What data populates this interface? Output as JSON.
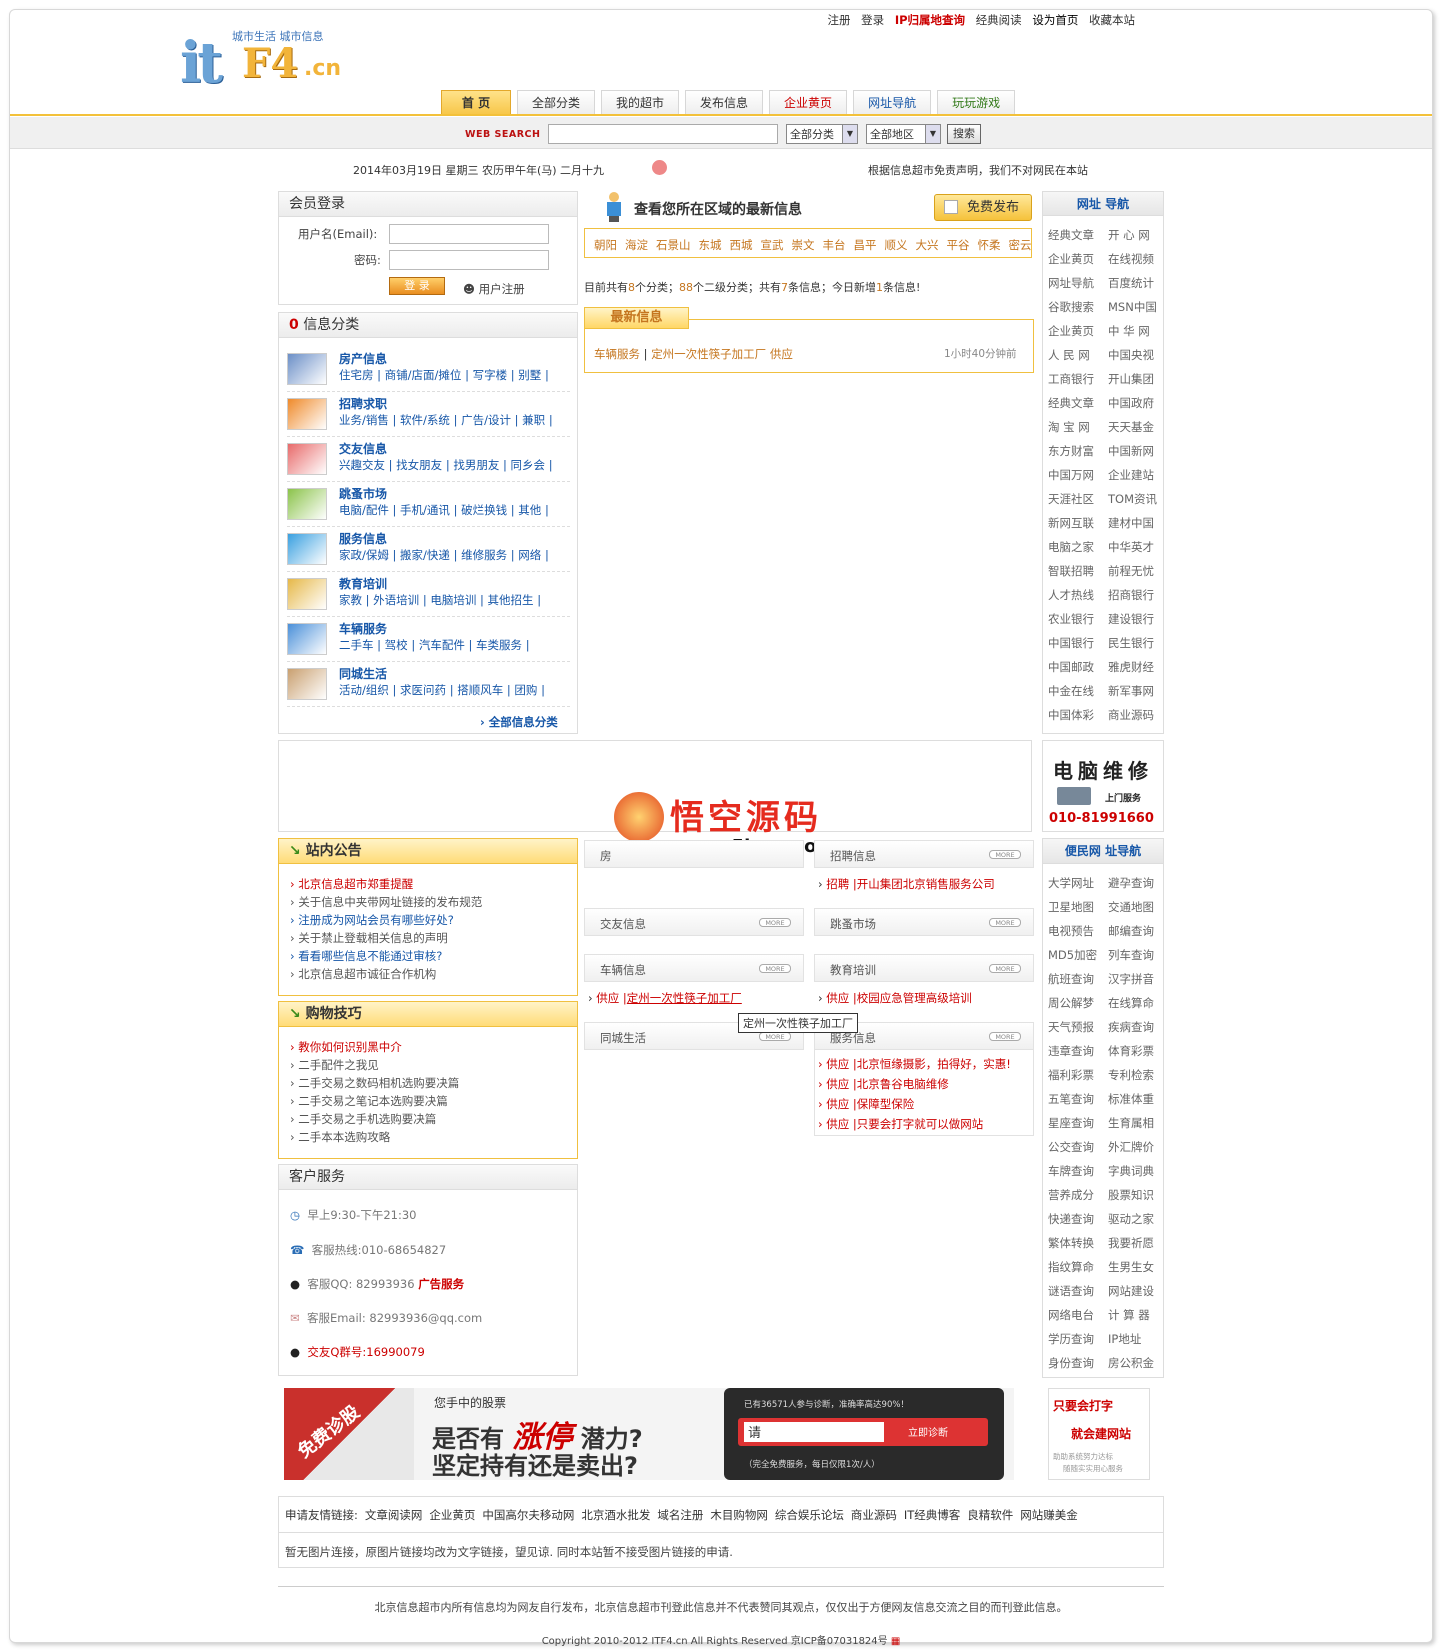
{
  "header": {
    "logo_tagline": "城市生活  城市信息",
    "logo_it": "it",
    "logo_f4": "F4",
    "logo_cn": ".cn",
    "top_links": [
      "注册",
      "登录",
      "IP归属地查询",
      "经典阅读",
      "设为首页",
      "收藏本站"
    ]
  },
  "tabs": [
    "首 页",
    "全部分类",
    "我的超市",
    "发布信息",
    "企业黄页",
    "网址导航",
    "玩玩游戏"
  ],
  "search": {
    "label": "WEB SEARCH",
    "category": "全部分类",
    "region": "全部地区",
    "button": "搜索"
  },
  "date_text": "2014年03月19日  星期三  农历甲午年(马) 二月十九",
  "notice_text": "根据信息超市免责声明，我们不对网民在本站",
  "login": {
    "title": "会员登录",
    "username_label": "用户名(Email):",
    "password_label": "密码:",
    "login_button": "登 录",
    "register": "用户注册"
  },
  "categories": {
    "title_num": "0",
    "title": "信息分类",
    "more": "全部信息分类",
    "items": [
      {
        "title": "房产信息",
        "subs": "住宅房 | 商铺/店面/摊位 | 写字楼 | 别墅 |",
        "color": "#6b8fc7"
      },
      {
        "title": "招聘求职",
        "subs": "业务/销售 | 软件/系统 | 广告/设计 | 兼职 |",
        "color": "#ef8a2a"
      },
      {
        "title": "交友信息",
        "subs": "兴趣交友 | 找女朋友 | 找男朋友 | 同乡会 |",
        "color": "#e86a6a"
      },
      {
        "title": "跳蚤市场",
        "subs": "电脑/配件 | 手机/通讯 | 破烂换钱 | 其他 |",
        "color": "#8bc34a"
      },
      {
        "title": "服务信息",
        "subs": "家政/保姆 | 搬家/快递 | 维修服务 | 网络 |",
        "color": "#39a0e0"
      },
      {
        "title": "教育培训",
        "subs": "家教 | 外语培训 | 电脑培训 | 其他招生 |",
        "color": "#e6b848"
      },
      {
        "title": "车辆服务",
        "subs": "二手车 | 驾校 | 汽车配件 | 车类服务 |",
        "color": "#4a90d9"
      },
      {
        "title": "同城生活",
        "subs": "活动/组织 | 求医问药 | 搭顺风车 | 团购 |",
        "color": "#c9a070"
      }
    ]
  },
  "region": {
    "title": "查看您所在区域的最新信息",
    "publish": "免费发布",
    "districts": [
      "朝阳",
      "海淀",
      "石景山",
      "东城",
      "西城",
      "宣武",
      "崇文",
      "丰台",
      "昌平",
      "顺义",
      "大兴",
      "平谷",
      "怀柔",
      "密云"
    ],
    "stats_prefix": "目前共有",
    "stats_num1": "8",
    "stats_mid1": "个分类；",
    "stats_num2": "88",
    "stats_mid2": "个二级分类；共有",
    "stats_num3": "7",
    "stats_mid3": "条信息；今日新增",
    "stats_num4": "1",
    "stats_suffix": "条信息!"
  },
  "latest": {
    "title": "最新信息",
    "category": "车辆服务",
    "item": "定州一次性筷子加工厂",
    "tag": "供应",
    "time": "1小时40分钟前"
  },
  "sitenav": {
    "title": "网址 导航",
    "links": [
      "经典文章",
      "开 心 网",
      "企业黄页",
      "在线视频",
      "网址导航",
      "百度统计",
      "谷歌搜索",
      "MSN中国",
      "企业黄页",
      "中 华 网",
      "人 民 网",
      "中国央视",
      "工商银行",
      "开山集团",
      "经典文章",
      "中国政府",
      "淘 宝 网",
      "天天基金",
      "东方财富",
      "中国新网",
      "中国万网",
      "企业建站",
      "天涯社区",
      "TOM资讯",
      "新网互联",
      "建材中国",
      "电脑之家",
      "中华英才",
      "智联招聘",
      "前程无忧",
      "人才热线",
      "招商银行",
      "农业银行",
      "建设银行",
      "中国银行",
      "民生银行",
      "中国邮政",
      "雅虎财经",
      "中金在线",
      "新军事网",
      "中国体彩",
      "商业源码"
    ]
  },
  "ad_repair": {
    "title": "电脑维修",
    "sub": "上门服务",
    "phone": "010-81991660"
  },
  "watermark": {
    "title": "悟空源码",
    "url": "www.5kym.com"
  },
  "announce": {
    "title": "站内公告",
    "items": [
      {
        "text": "北京信息超市郑重提醒",
        "style": "red"
      },
      {
        "text": "关于信息中夹带网址链接的发布规范",
        "style": ""
      },
      {
        "text": "注册成为网站会员有哪些好处?",
        "style": "blue"
      },
      {
        "text": "关于禁止登载相关信息的声明",
        "style": ""
      },
      {
        "text": "看看哪些信息不能通过审核?",
        "style": "blue"
      },
      {
        "text": "北京信息超市诚征合作机构",
        "style": ""
      }
    ]
  },
  "shopping": {
    "title": "购物技巧",
    "items": [
      {
        "text": "教你如何识别黑中介",
        "style": "red"
      },
      {
        "text": "二手配件之我见",
        "style": ""
      },
      {
        "text": "二手交易之数码相机选购要决篇",
        "style": ""
      },
      {
        "text": "二手交易之笔记本选购要决篇",
        "style": ""
      },
      {
        "text": "二手交易之手机选购要决篇",
        "style": ""
      },
      {
        "text": "二手本本选购攻略",
        "style": ""
      }
    ]
  },
  "service": {
    "title": "客户服务",
    "hours": "早上9:30-下午21:30",
    "hotline": "客服热线:010-68654827",
    "qq": "客服QQ: 82993936",
    "qq_ad": "广告服务",
    "email": "客服Email: 82993936@qq.com",
    "group": "交友Q群号:16990079"
  },
  "mid_sections": {
    "house": "房",
    "job": "招聘信息",
    "job_item_tag": "招聘",
    "job_item": "开山集团北京销售服务公司",
    "friend": "交友信息",
    "flea": "跳蚤市场",
    "car": "车辆信息",
    "car_item_tag": "供应",
    "car_item": "定州一次性筷子加工厂",
    "edu": "教育培训",
    "edu_item_tag": "供应",
    "edu_item": "校园应急管理高级培训",
    "life": "同城生活",
    "service": "服务信息",
    "tooltip": "定州一次性筷子加工厂",
    "service_items": [
      {
        "tag": "供应",
        "text": "北京恒缘摄影，拍得好，实惠!"
      },
      {
        "tag": "供应",
        "text": "北京鲁谷电脑维修"
      },
      {
        "tag": "供应",
        "text": "保障型保险"
      },
      {
        "tag": "供应",
        "text": "只要会打字就可以做网站"
      }
    ],
    "more": "MORE"
  },
  "convnav": {
    "title": "便民网 址导航",
    "links": [
      "大学网址",
      "避孕查询",
      "卫星地图",
      "交通地图",
      "电视预告",
      "邮编查询",
      "MD5加密",
      "列车查询",
      "航班查询",
      "汉字拼音",
      "周公解梦",
      "在线算命",
      "天气预报",
      "疾病查询",
      "违章查询",
      "体育彩票",
      "福利彩票",
      "专利检索",
      "五笔查询",
      "标准体重",
      "星座查询",
      "生育属相",
      "公交查询",
      "外汇牌价",
      "车牌查询",
      "字典词典",
      "营养成分",
      "股票知识",
      "快递查询",
      "驱动之家",
      "繁体转换",
      "我要祈愿",
      "指纹算命",
      "生男生女",
      "谜语查询",
      "网站建设",
      "网络电台",
      "计 算 器",
      "学历查询",
      "IP地址",
      "身份查询",
      "房公积金"
    ]
  },
  "stock_ad": {
    "badge": "免费诊股",
    "l1": "您手中的股票",
    "l2a": "是否有",
    "l2b": "涨停",
    "l2c": "潜力?",
    "l3": "坚定持有还是卖出?",
    "r1": "已有36571人参与诊断，准确率高达90%！",
    "input": "请",
    "btn": "立即诊断",
    "r3": "（完全免费服务，每日仅限1次/人）"
  },
  "side_ad": {
    "l1": "只要会打字",
    "l2": "就会建网站",
    "l3": "助助系统努力达标",
    "l4": "随随实实用心服务"
  },
  "friend_links": {
    "label": "申请友情链接:",
    "links": [
      "文章阅读网",
      "企业黄页",
      "中国高尔夫移动网",
      "北京酒水批发",
      "域名注册",
      "木目购物网",
      "综合娱乐论坛",
      "商业源码",
      "IT经典博客",
      "良精软件",
      "网站赚美金"
    ]
  },
  "img_links_notice": "暂无图片连接，原图片链接均改为文字链接，望见谅. 同时本站暂不接受图片链接的申请.",
  "footer": {
    "disclaimer": "北京信息超市内所有信息均为网友自行发布，北京信息超市刊登此信息并不代表赞同其观点，仅仅出于方便网友信息交流之目的而刊登此信息。",
    "copyright": "Copyright 2010-2012 ITF4.cn All Rights Reserved 京ICP备07031824号"
  }
}
